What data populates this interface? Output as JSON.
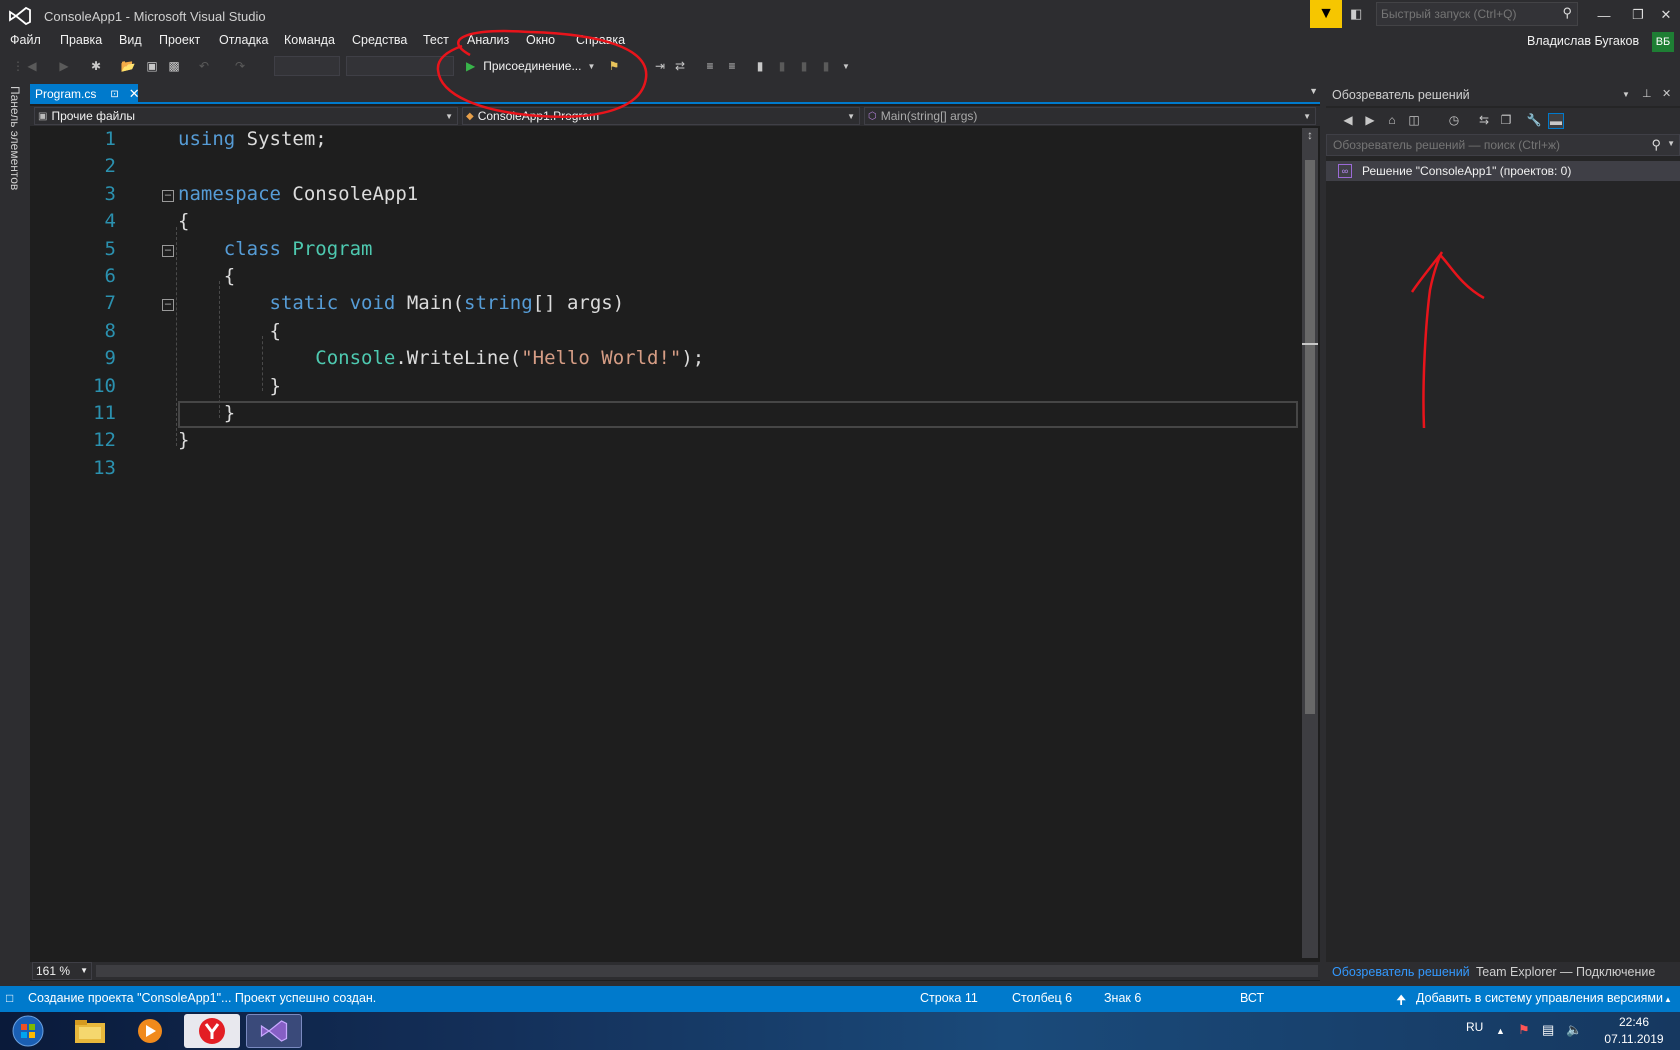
{
  "window": {
    "title": "ConsoleApp1 - Microsoft Visual Studio",
    "quick_launch_placeholder": "Быстрый запуск (Ctrl+Q)",
    "icons": [
      "vs-logo-icon",
      "filter-icon",
      "feedback-icon",
      "search-icon",
      "minimize-icon",
      "restore-icon",
      "close-icon"
    ]
  },
  "menu": {
    "items": [
      "Файл",
      "Правка",
      "Вид",
      "Проект",
      "Отладка",
      "Команда",
      "Средства",
      "Тест",
      "Анализ",
      "Окно",
      "Справка"
    ],
    "user_name": "Владислав Бугаков",
    "user_initials": "ВБ"
  },
  "toolbar": {
    "attach_label": "Присоединение..."
  },
  "left_panel": {
    "toolbox_label": "Панель элементов"
  },
  "editor": {
    "tab_label": "Program.cs",
    "nav": {
      "project": "Прочие файлы",
      "class": "ConsoleApp1.Program",
      "member": "Main(string[] args)"
    },
    "zoom": "161 %",
    "current_line": 11,
    "code_lines": [
      {
        "n": "1",
        "fold": false
      },
      {
        "n": "2",
        "fold": false
      },
      {
        "n": "3",
        "fold": true
      },
      {
        "n": "4",
        "fold": false
      },
      {
        "n": "5",
        "fold": true
      },
      {
        "n": "6",
        "fold": false
      },
      {
        "n": "7",
        "fold": true
      },
      {
        "n": "8",
        "fold": false
      },
      {
        "n": "9",
        "fold": false
      },
      {
        "n": "10",
        "fold": false
      },
      {
        "n": "11",
        "fold": false
      },
      {
        "n": "12",
        "fold": false
      },
      {
        "n": "13",
        "fold": false
      }
    ],
    "tokens": {
      "using": "using",
      "system": "System;",
      "namespace": "namespace",
      "ns_name": "ConsoleApp1",
      "open_brace": "{",
      "close_brace": "}",
      "class": "class",
      "class_name": "Program",
      "static": "static",
      "void": "void",
      "main": "Main(",
      "string": "string",
      "args": "[] args)",
      "console": "Console",
      "writeline": ".WriteLine(",
      "hello": "\"Hello World!\"",
      "end_call": ");"
    },
    "syntax_colors": {
      "keyword": "#569cd6",
      "type": "#4ec9b0",
      "string": "#d69d85",
      "line_number": "#2b91af"
    }
  },
  "solution_explorer": {
    "title": "Обозреватель решений",
    "search_placeholder": "Обозреватель решений — поиск (Ctrl+ж)",
    "root_label": "Решение \"ConsoleApp1\"  (проектов: 0)",
    "tab_active": "Обозреватель решений",
    "tab_other": "Team Explorer — Подключение"
  },
  "statusbar": {
    "message": "Создание проекта \"ConsoleApp1\"... Проект успешно создан.",
    "row": "Строка 11",
    "col": "Столбец 6",
    "char": "Знак 6",
    "mode": "ВСТ",
    "vcs": "Добавить в систему управления версиями",
    "accent": "#007acc"
  },
  "taskbar": {
    "lang": "RU",
    "time": "22:46",
    "date": "07.11.2019",
    "apps": [
      "windows-start-icon",
      "file-explorer-icon",
      "media-player-icon",
      "yandex-browser-icon",
      "visual-studio-icon"
    ]
  },
  "annotation_color": "#e8141b"
}
